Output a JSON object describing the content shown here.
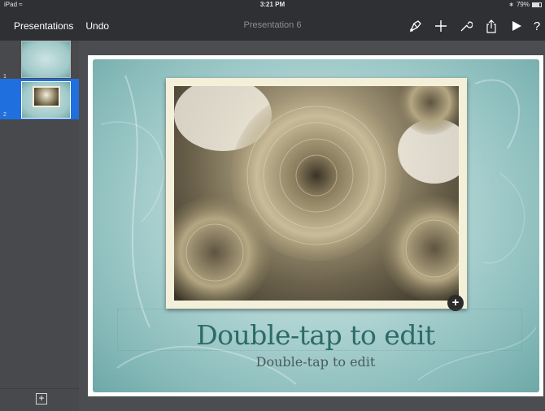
{
  "status_bar": {
    "device": "iPad",
    "wifi_icon": "wifi-icon",
    "time": "3:21 PM",
    "bluetooth_icon": "bluetooth-icon",
    "battery": "79%",
    "battery_level": 0.79
  },
  "toolbar": {
    "presentations_label": "Presentations",
    "undo_label": "Undo",
    "title": "Presentation 6",
    "icons": [
      "format-brush-icon",
      "plus-icon",
      "wrench-icon",
      "share-icon",
      "play-icon",
      "help-icon"
    ],
    "help_label": "?"
  },
  "sidebar": {
    "slides": [
      {
        "number": "1",
        "selected": false
      },
      {
        "number": "2",
        "selected": true
      }
    ],
    "add_slide_label": "+"
  },
  "slide": {
    "title": "Double-tap to edit",
    "subtitle": "Double-tap to edit",
    "media_add_label": "+"
  },
  "colors": {
    "toolbar_bg": "#2f3034",
    "selected_thumb": "#1f6fde",
    "title_color": "#2c6b69",
    "slide_teal": "#aed3d2"
  }
}
